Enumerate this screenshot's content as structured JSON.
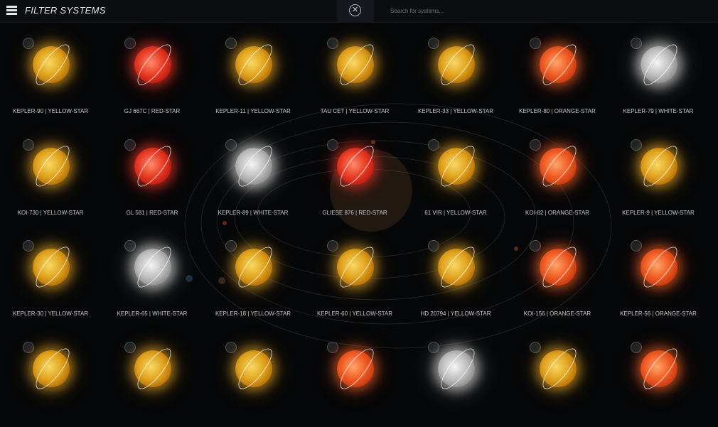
{
  "header": {
    "title": "FILTER SYSTEMS",
    "search_placeholder": "Search for systems..."
  },
  "colors": {
    "yellow-star": "#e0a21c",
    "red-star": "#e63a24",
    "orange-star": "#ef5a22",
    "white-star": "#bdbdbd"
  },
  "systems": [
    {
      "label": "KEPLER-90 | YELLOW-STAR",
      "type": "yellow"
    },
    {
      "label": "GJ 667C | RED-STAR",
      "type": "red"
    },
    {
      "label": "KEPLER-11 | YELLOW-STAR",
      "type": "yellow"
    },
    {
      "label": "TAU CET | YELLOW-STAR",
      "type": "yellow"
    },
    {
      "label": "KEPLER-33 | YELLOW-STAR",
      "type": "yellow"
    },
    {
      "label": "KEPLER-80 | ORANGE-STAR",
      "type": "orange"
    },
    {
      "label": "KEPLER-79 | WHITE-STAR",
      "type": "white"
    },
    {
      "label": "KOI-730 | YELLOW-STAR",
      "type": "yellow"
    },
    {
      "label": "GL 581 | RED-STAR",
      "type": "red"
    },
    {
      "label": "KEPLER-89 | WHITE-STAR",
      "type": "white"
    },
    {
      "label": "GLIESE 876 | RED-STAR",
      "type": "red"
    },
    {
      "label": "61 VIR | YELLOW-STAR",
      "type": "yellow"
    },
    {
      "label": "KOI-82 | ORANGE-STAR",
      "type": "orange"
    },
    {
      "label": "KEPLER-9 | YELLOW-STAR",
      "type": "yellow"
    },
    {
      "label": "KEPLER-30 | YELLOW-STAR",
      "type": "yellow"
    },
    {
      "label": "KEPLER-65 | WHITE-STAR",
      "type": "white"
    },
    {
      "label": "KEPLER-18 | YELLOW-STAR",
      "type": "yellow"
    },
    {
      "label": "KEPLER-60 | YELLOW-STAR",
      "type": "yellow"
    },
    {
      "label": "HD 20794 | YELLOW-STAR",
      "type": "yellow"
    },
    {
      "label": "KOI-156 | ORANGE-STAR",
      "type": "orange"
    },
    {
      "label": "KEPLER-56 | ORANGE-STAR",
      "type": "orange"
    },
    {
      "label": "",
      "type": "yellow"
    },
    {
      "label": "",
      "type": "yellow"
    },
    {
      "label": "",
      "type": "yellow"
    },
    {
      "label": "",
      "type": "orange"
    },
    {
      "label": "",
      "type": "white"
    },
    {
      "label": "",
      "type": "yellow"
    },
    {
      "label": "",
      "type": "orange"
    }
  ]
}
